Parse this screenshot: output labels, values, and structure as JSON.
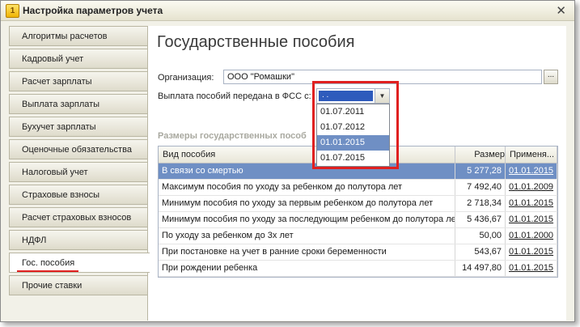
{
  "window": {
    "title": "Настройка параметров учета"
  },
  "tabs": [
    "Алгоритмы расчетов",
    "Кадровый учет",
    "Расчет зарплаты",
    "Выплата зарплаты",
    "Бухучет зарплаты",
    "Оценочные обязательства",
    "Налоговый учет",
    "Страховые взносы",
    "Расчет страховых взносов",
    "НДФЛ",
    "Гос. пособия",
    "Прочие ставки"
  ],
  "active_tab": "Гос. пособия",
  "page": {
    "title": "Государственные пособия",
    "org_label": "Организация:",
    "org_value": "ООО \"Ромашки\"",
    "org_button": "...",
    "fss_label": "Выплата пособий передана в ФСС с:",
    "fss_value": "  .  .",
    "dropdown_options": [
      "01.07.2011",
      "01.07.2012",
      "01.01.2015",
      "01.07.2015"
    ],
    "dropdown_selected": "01.01.2015",
    "section_title": "Размеры государственных пособ"
  },
  "table": {
    "headers": [
      "Вид пособия",
      "Размер",
      "Применя..."
    ],
    "rows": [
      {
        "name": "В связи со смертью",
        "size": "5 277,28",
        "date": "01.01.2015",
        "selected": true
      },
      {
        "name": "Максимум пособия по уходу за ребенком до полутора лет",
        "size": "7 492,40",
        "date": "01.01.2009"
      },
      {
        "name": "Минимум пособия по уходу за первым ребенком до полутора лет",
        "size": "2 718,34",
        "date": "01.01.2015"
      },
      {
        "name": "Минимум пособия по уходу за последующим ребенком до полутора лет",
        "size": "5 436,67",
        "date": "01.01.2015"
      },
      {
        "name": "По уходу за ребенком до 3х лет",
        "size": "50,00",
        "date": "01.01.2000"
      },
      {
        "name": "При постановке на учет в ранние сроки беременности",
        "size": "543,67",
        "date": "01.01.2015"
      },
      {
        "name": "При рождении ребенка",
        "size": "14 497,80",
        "date": "01.01.2015"
      }
    ]
  },
  "colors": {
    "highlight": "#e02020",
    "selection": "#6f8fc4",
    "date_selection": "#2e5bbc"
  },
  "icons": {
    "app": "1c-app-icon",
    "close": "close-icon",
    "dropdown": "chevron-down-icon"
  }
}
